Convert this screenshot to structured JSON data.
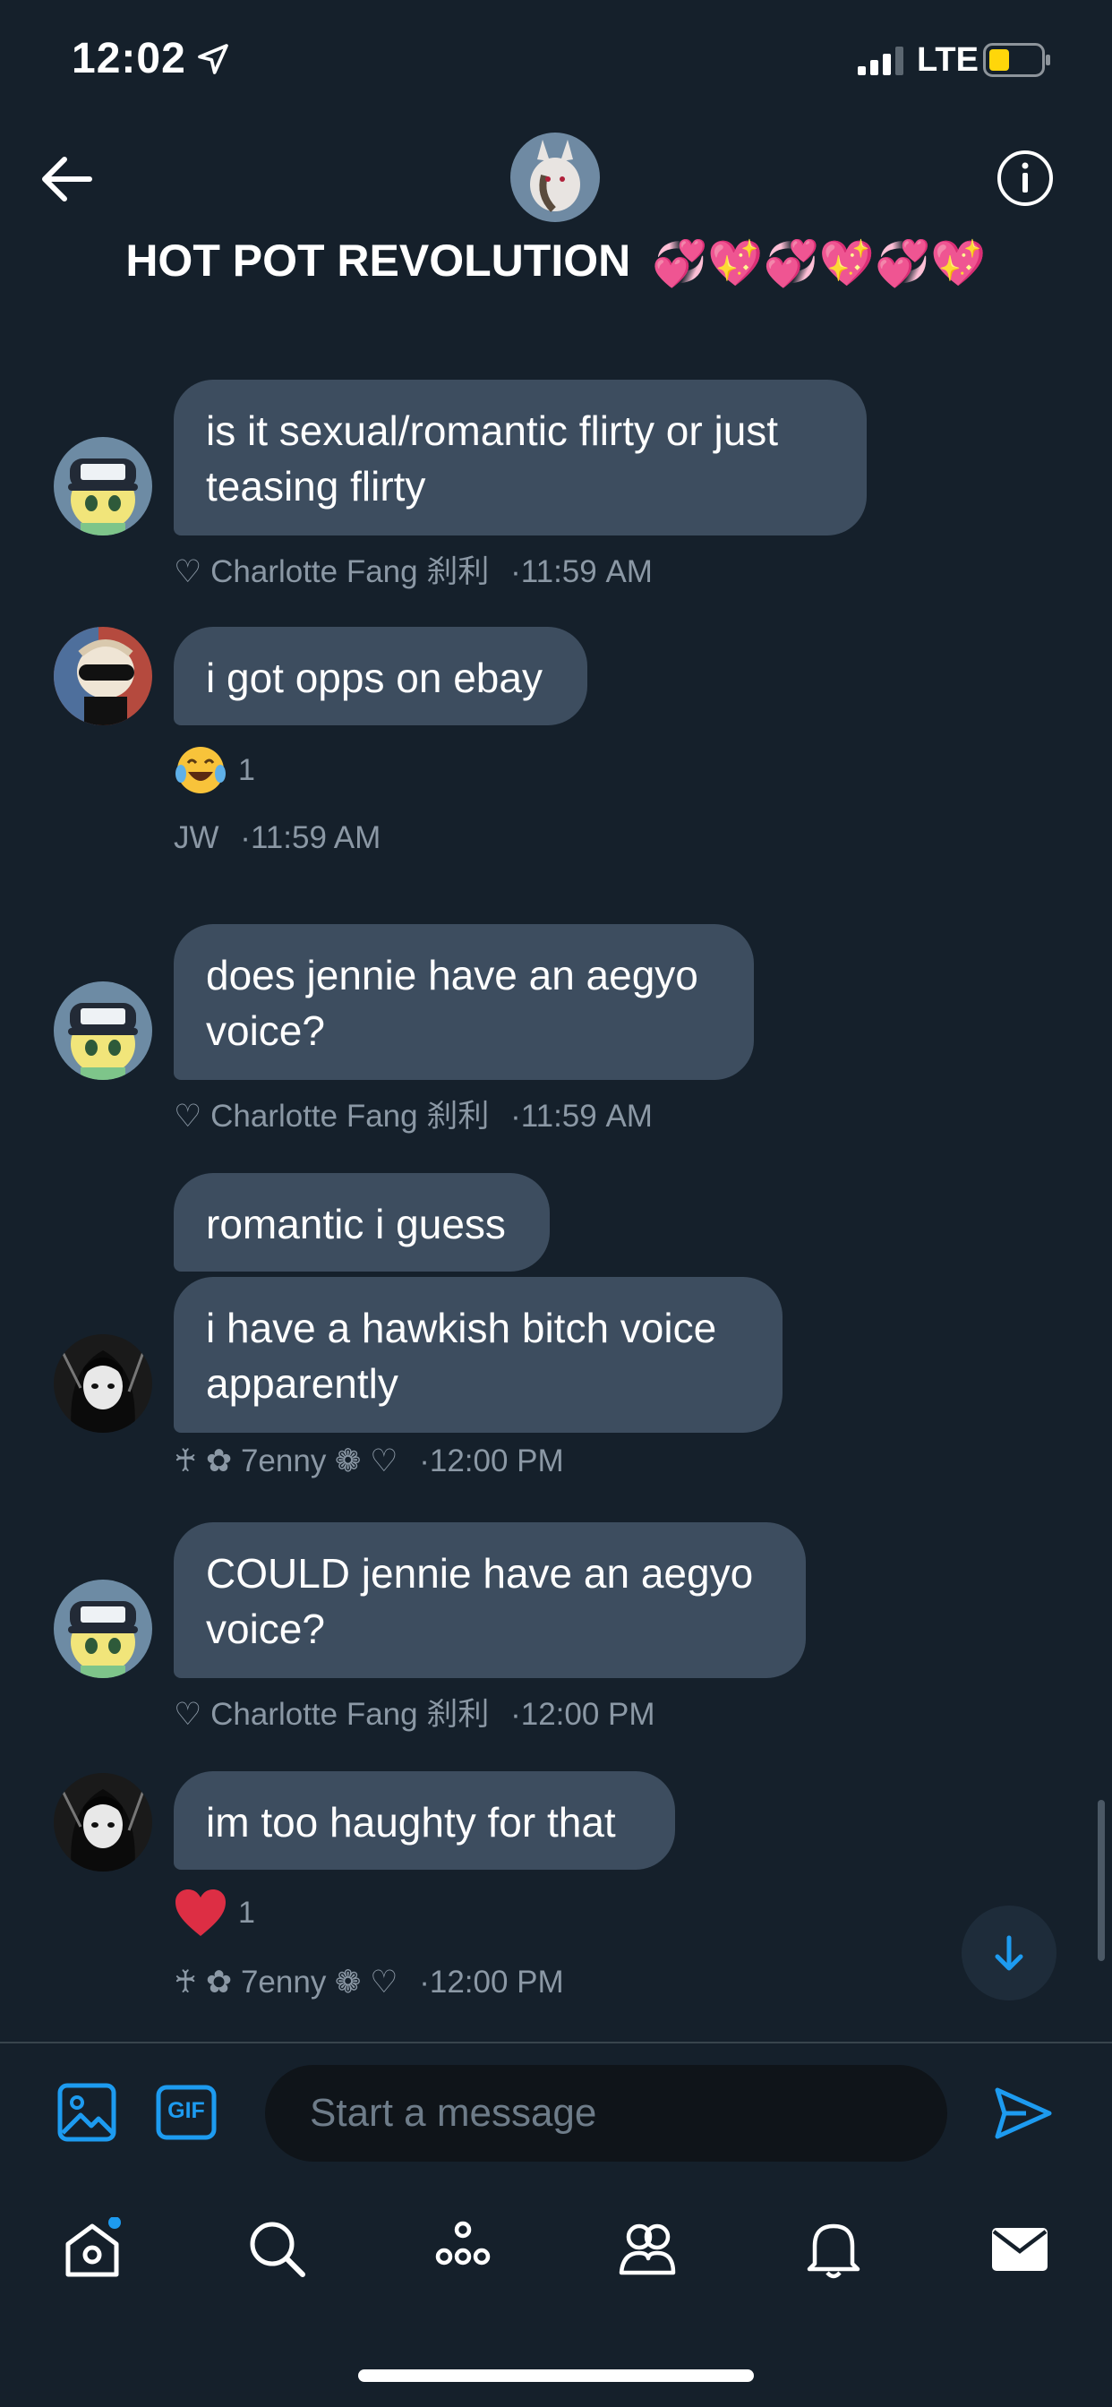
{
  "status_bar": {
    "time": "12:02",
    "network": "LTE",
    "battery_color": "#ffd60a"
  },
  "header": {
    "title": "HOT POT REVOLUTION",
    "title_emoji": "💞💖💞💖💞💖"
  },
  "messages": [
    {
      "sender": "♡ Charlotte Fang 刹利",
      "time": "11:59 AM",
      "bubbles": [
        "is it sexual/romantic flirty or just teasing flirty"
      ]
    },
    {
      "sender": "JW",
      "time": "11:59 AM",
      "bubbles": [
        "i got opps on ebay"
      ],
      "reaction": {
        "emoji": "laughing-tears",
        "count": "1"
      }
    },
    {
      "sender": "♡ Charlotte Fang 刹利",
      "time": "11:59 AM",
      "bubbles": [
        "does jennie have an aegyo voice?"
      ]
    },
    {
      "sender": "♰ ✿ 7enny ❁ ♡",
      "time": "12:00 PM",
      "bubbles": [
        "romantic i guess",
        "i have a hawkish bitch voice apparently"
      ]
    },
    {
      "sender": "♡ Charlotte Fang 刹利",
      "time": "12:00 PM",
      "bubbles": [
        "COULD jennie have an aegyo voice?"
      ]
    },
    {
      "sender": "♰ ✿ 7enny ❁ ♡",
      "time": "12:00 PM",
      "bubbles": [
        "im too haughty for that"
      ],
      "reaction": {
        "emoji": "red-heart",
        "count": "1"
      }
    }
  ],
  "meta_separator": "·",
  "composer": {
    "placeholder": "Start a message",
    "gif_label": "GIF"
  },
  "colors": {
    "accent": "#1d9bf0",
    "bubble": "#3d4d5f",
    "background": "#15202b",
    "meta_text": "#8b98a5"
  }
}
